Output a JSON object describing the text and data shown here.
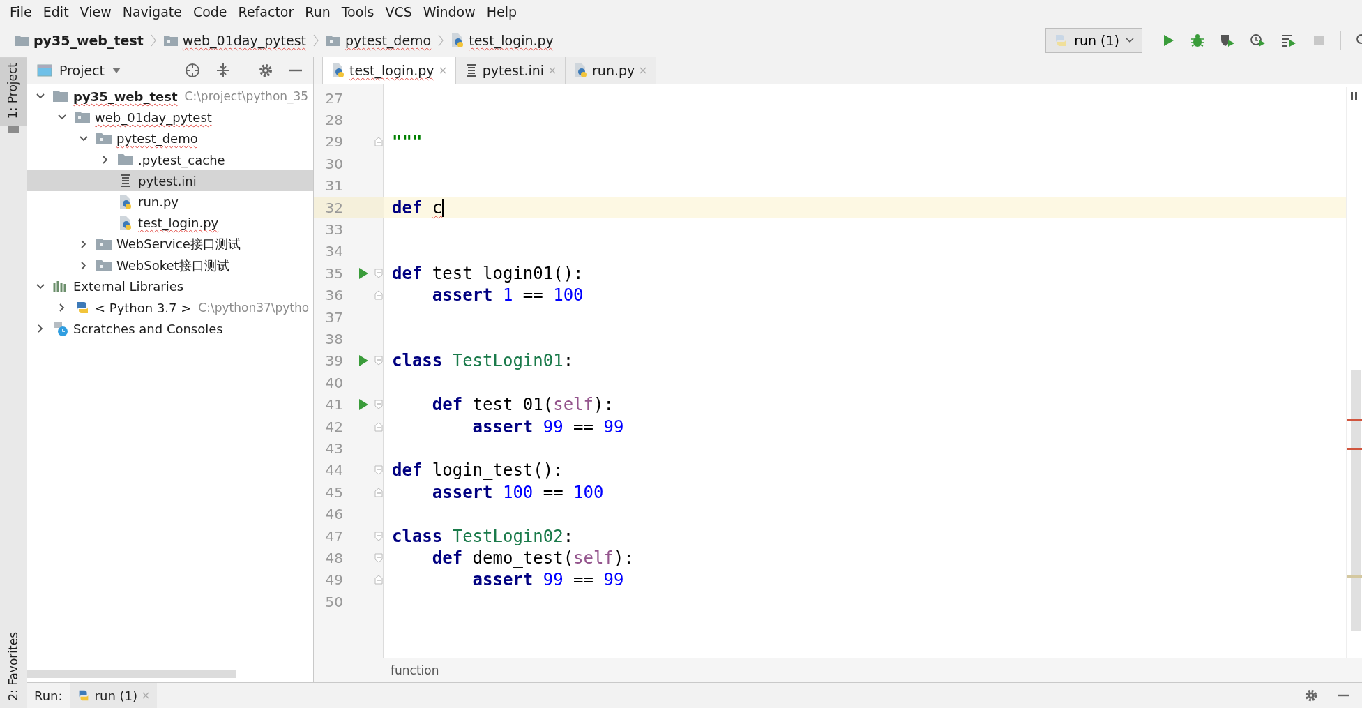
{
  "menu": [
    "File",
    "Edit",
    "View",
    "Navigate",
    "Code",
    "Refactor",
    "Run",
    "Tools",
    "VCS",
    "Window",
    "Help"
  ],
  "breadcrumbs": [
    {
      "label": "py35_web_test",
      "kind": "project",
      "typo": false
    },
    {
      "label": "web_01day_pytest",
      "kind": "folder",
      "typo": true
    },
    {
      "label": "pytest_demo",
      "kind": "folder",
      "typo": true
    },
    {
      "label": "test_login.py",
      "kind": "python",
      "typo": true
    }
  ],
  "run_config": {
    "label": "run (1)"
  },
  "side_stripe": {
    "top": {
      "label": "1: Project",
      "selected": true
    },
    "bottom": {
      "label": "2: Favorites",
      "selected": false
    }
  },
  "project_panel": {
    "title": "Project",
    "tree": [
      {
        "label": "py35_web_test",
        "hint": "C:\\project\\python_35",
        "kind": "project",
        "typo": true,
        "selected": false,
        "expanded": true,
        "children": [
          {
            "label": "web_01day_pytest",
            "kind": "folder",
            "typo": true,
            "selected": false,
            "expanded": true,
            "children": [
              {
                "label": "pytest_demo",
                "kind": "folder",
                "typo": true,
                "selected": false,
                "expanded": true,
                "children": [
                  {
                    "label": ".pytest_cache",
                    "kind": "plain_folder",
                    "typo": false,
                    "selected": false,
                    "expanded": false
                  },
                  {
                    "label": "pytest.ini",
                    "kind": "ini",
                    "typo": false,
                    "selected": true
                  },
                  {
                    "label": "run.py",
                    "kind": "python",
                    "typo": false,
                    "selected": false
                  },
                  {
                    "label": "test_login.py",
                    "kind": "python",
                    "typo": true,
                    "selected": false
                  }
                ]
              },
              {
                "label": "WebService接口测试",
                "kind": "folder",
                "typo": false,
                "selected": false,
                "expanded": false
              },
              {
                "label": "WebSoket接口测试",
                "kind": "folder",
                "typo": false,
                "selected": false,
                "expanded": false
              }
            ]
          }
        ]
      },
      {
        "label": "External Libraries",
        "kind": "libraries",
        "typo": false,
        "selected": false,
        "expanded": true,
        "children": [
          {
            "label": "< Python 3.7 >",
            "hint": "C:\\python37\\pytho",
            "kind": "sdk",
            "typo": false,
            "selected": false,
            "expanded": false
          }
        ]
      },
      {
        "label": "Scratches and Consoles",
        "kind": "scratches",
        "typo": false,
        "selected": false,
        "expanded": false
      }
    ]
  },
  "tabs": [
    {
      "label": "test_login.py",
      "kind": "python",
      "typo": true,
      "selected": true
    },
    {
      "label": "pytest.ini",
      "kind": "ini",
      "typo": false,
      "selected": false
    },
    {
      "label": "run.py",
      "kind": "python",
      "typo": false,
      "selected": false
    }
  ],
  "editor": {
    "lines": [
      {
        "number": "27"
      },
      {
        "number": "28"
      },
      {
        "number": "29",
        "fold_end": true,
        "tokens": [
          {
            "text": "\"\"\"",
            "kind": "string"
          }
        ]
      },
      {
        "number": "30"
      },
      {
        "number": "31"
      },
      {
        "number": "32",
        "current": true,
        "caret": true,
        "tokens": [
          {
            "text": "def ",
            "kind": "keyword"
          },
          {
            "text": "c",
            "kind": "plain",
            "typo": true
          }
        ]
      },
      {
        "number": "33"
      },
      {
        "number": "34"
      },
      {
        "number": "35",
        "run": true,
        "fold_start": true,
        "tokens": [
          {
            "text": "def",
            "kind": "keyword"
          },
          {
            "text": " test_login01():",
            "kind": "plain"
          }
        ]
      },
      {
        "number": "36",
        "fold_end": true,
        "tokens": [
          {
            "text": "    assert",
            "kind": "keyword"
          },
          {
            "text": " 1",
            "kind": "number"
          },
          {
            "text": " == ",
            "kind": "plain"
          },
          {
            "text": "100",
            "kind": "number"
          }
        ]
      },
      {
        "number": "37"
      },
      {
        "number": "38"
      },
      {
        "number": "39",
        "run": true,
        "fold_start": true,
        "tokens": [
          {
            "text": "class",
            "kind": "keyword"
          },
          {
            "text": " TestLogin01",
            "kind": "class"
          },
          {
            "text": ":",
            "kind": "plain"
          }
        ]
      },
      {
        "number": "40"
      },
      {
        "number": "41",
        "run": true,
        "fold_start": true,
        "tokens": [
          {
            "text": "    def",
            "kind": "keyword"
          },
          {
            "text": " test_01(",
            "kind": "plain"
          },
          {
            "text": "self",
            "kind": "self"
          },
          {
            "text": "):",
            "kind": "plain"
          }
        ]
      },
      {
        "number": "42",
        "fold_end": true,
        "tokens": [
          {
            "text": "        assert",
            "kind": "keyword"
          },
          {
            "text": " 99",
            "kind": "number"
          },
          {
            "text": " == ",
            "kind": "plain"
          },
          {
            "text": "99",
            "kind": "number"
          }
        ]
      },
      {
        "number": "43"
      },
      {
        "number": "44",
        "fold_start": true,
        "tokens": [
          {
            "text": "def",
            "kind": "keyword"
          },
          {
            "text": " login_test():",
            "kind": "plain"
          }
        ]
      },
      {
        "number": "45",
        "fold_end": true,
        "tokens": [
          {
            "text": "    assert",
            "kind": "keyword"
          },
          {
            "text": " 100",
            "kind": "number"
          },
          {
            "text": " == ",
            "kind": "plain"
          },
          {
            "text": "100",
            "kind": "number"
          }
        ]
      },
      {
        "number": "46"
      },
      {
        "number": "47",
        "fold_start": true,
        "tokens": [
          {
            "text": "class",
            "kind": "keyword"
          },
          {
            "text": " TestLogin02",
            "kind": "class"
          },
          {
            "text": ":",
            "kind": "plain"
          }
        ]
      },
      {
        "number": "48",
        "fold_start": true,
        "tokens": [
          {
            "text": "    def",
            "kind": "keyword"
          },
          {
            "text": " demo_test(",
            "kind": "plain"
          },
          {
            "text": "self",
            "kind": "self"
          },
          {
            "text": "):",
            "kind": "plain"
          }
        ]
      },
      {
        "number": "49",
        "fold_end": true,
        "tokens": [
          {
            "text": "        assert",
            "kind": "keyword"
          },
          {
            "text": " 99",
            "kind": "number"
          },
          {
            "text": " == ",
            "kind": "plain"
          },
          {
            "text": "99",
            "kind": "number"
          }
        ]
      },
      {
        "number": "50"
      }
    ],
    "status": "function"
  },
  "run_bar": {
    "label": "Run:",
    "tab": "run (1)"
  }
}
